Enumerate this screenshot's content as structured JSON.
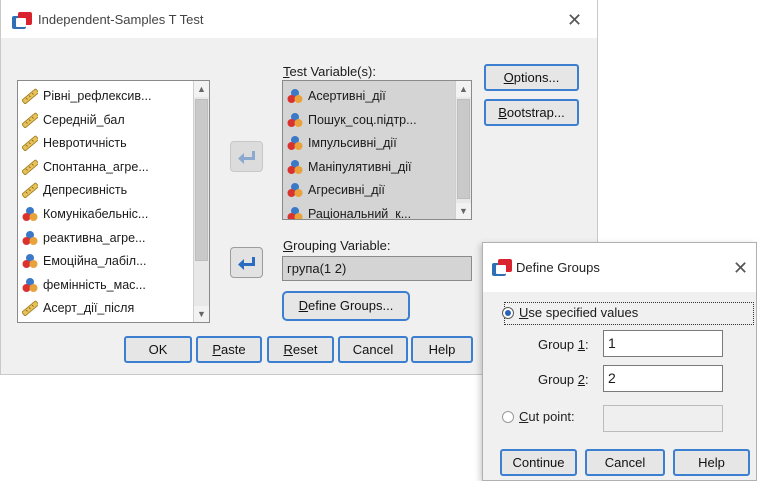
{
  "main_dialog": {
    "title": "Independent-Samples T Test",
    "source_vars": [
      {
        "label": "Рівні_рефлексив...",
        "icon": "ruler-icon"
      },
      {
        "label": "Середній_бал",
        "icon": "ruler-icon"
      },
      {
        "label": "Невротичність",
        "icon": "ruler-icon"
      },
      {
        "label": "Спонтанна_агре...",
        "icon": "ruler-icon"
      },
      {
        "label": "Депресивність",
        "icon": "ruler-icon"
      },
      {
        "label": "Комунікабельніс...",
        "icon": "nominal-icon"
      },
      {
        "label": "реактивна_агре...",
        "icon": "nominal-icon"
      },
      {
        "label": "Емоційна_лабіл...",
        "icon": "nominal-icon"
      },
      {
        "label": "фемінність_мас...",
        "icon": "nominal-icon"
      },
      {
        "label": "Асерт_дії_після",
        "icon": "ruler-icon"
      }
    ],
    "test_variables_label": "Test Variable(s):",
    "test_vars": [
      {
        "label": "Асертивні_дії",
        "icon": "nominal-icon"
      },
      {
        "label": "Пошук_соц.підтр...",
        "icon": "nominal-icon"
      },
      {
        "label": "Імпульсивні_дії",
        "icon": "nominal-icon"
      },
      {
        "label": "Маніпулятивні_дії",
        "icon": "nominal-icon"
      },
      {
        "label": "Агресивні_дії",
        "icon": "nominal-icon"
      },
      {
        "label": "Раціональний_к...",
        "icon": "nominal-icon"
      }
    ],
    "grouping_variable_label": "Grouping Variable:",
    "grouping_variable_value": "група(1 2)",
    "define_groups_label": "Define Groups...",
    "options_label": "Options...",
    "bootstrap_label": "Bootstrap...",
    "buttons": {
      "ok": "OK",
      "paste": "Paste",
      "reset": "Reset",
      "cancel": "Cancel",
      "help": "Help"
    }
  },
  "define_groups": {
    "title": "Define Groups",
    "use_specified_label": "Use specified values",
    "group1_label": "Group 1:",
    "group1_value": "1",
    "group2_label": "Group 2:",
    "group2_value": "2",
    "cut_point_label": "Cut point:",
    "cut_point_value": "",
    "buttons": {
      "continue": "Continue",
      "cancel": "Cancel",
      "help": "Help"
    }
  },
  "colors": {
    "accent": "#3c7fd0",
    "arrow": "#2a6cc0",
    "icon_red": "#d9242f",
    "icon_blue": "#2f6fb6"
  }
}
